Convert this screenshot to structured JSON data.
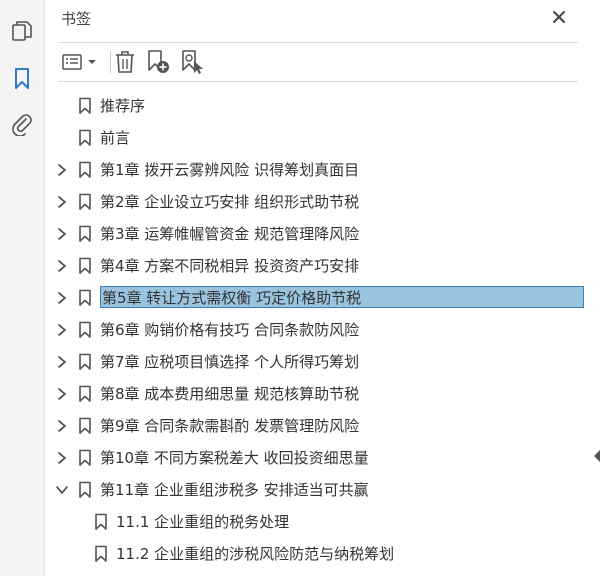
{
  "panel": {
    "title": "书签"
  },
  "colors": {
    "accent": "#2d7bc9",
    "selection_bg": "#99c3de",
    "selection_border": "#3f7fb0"
  },
  "rail": {
    "icons": [
      "pages-icon",
      "bookmark-icon",
      "attachment-icon"
    ],
    "active": "bookmark-icon"
  },
  "toolbar": {
    "icons": [
      "options-menu-icon",
      "delete-bookmark-icon",
      "new-bookmark-icon",
      "bookmark-from-selection-icon"
    ]
  },
  "bookmarks": [
    {
      "label": "推荐序",
      "level": 0,
      "expand": "none",
      "selected": false
    },
    {
      "label": "前言",
      "level": 0,
      "expand": "none",
      "selected": false
    },
    {
      "label": "第1章 拨开云雾辨风险 识得筹划真面目",
      "level": 0,
      "expand": "collapsed",
      "selected": false
    },
    {
      "label": "第2章 企业设立巧安排 组织形式助节税",
      "level": 0,
      "expand": "collapsed",
      "selected": false
    },
    {
      "label": "第3章 运筹帷幄管资金 规范管理降风险",
      "level": 0,
      "expand": "collapsed",
      "selected": false
    },
    {
      "label": "第4章 方案不同税相异 投资资产巧安排",
      "level": 0,
      "expand": "collapsed",
      "selected": false
    },
    {
      "label": "第5章 转让方式需权衡 巧定价格助节税",
      "level": 0,
      "expand": "collapsed",
      "selected": true
    },
    {
      "label": "第6章 购销价格有技巧 合同条款防风险",
      "level": 0,
      "expand": "collapsed",
      "selected": false
    },
    {
      "label": "第7章 应税项目慎选择 个人所得巧筹划",
      "level": 0,
      "expand": "collapsed",
      "selected": false
    },
    {
      "label": "第8章 成本费用细思量 规范核算助节税",
      "level": 0,
      "expand": "collapsed",
      "selected": false
    },
    {
      "label": "第9章 合同条款需斟酌 发票管理防风险",
      "level": 0,
      "expand": "collapsed",
      "selected": false
    },
    {
      "label": "第10章 不同方案税差大 收回投资细思量",
      "level": 0,
      "expand": "collapsed",
      "selected": false
    },
    {
      "label": "第11章 企业重组涉税多 安排适当可共赢",
      "level": 0,
      "expand": "expanded",
      "selected": false
    },
    {
      "label": "11.1 企业重组的税务处理",
      "level": 1,
      "expand": "none",
      "selected": false
    },
    {
      "label": "11.2 企业重组的涉税风险防范与纳税筹划",
      "level": 1,
      "expand": "none",
      "selected": false
    }
  ]
}
